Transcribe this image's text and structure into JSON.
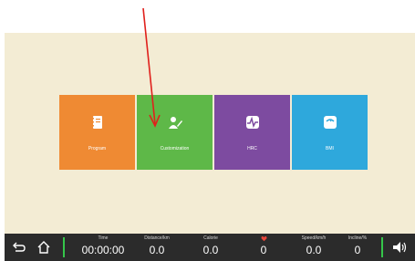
{
  "tiles": [
    {
      "label": "Program",
      "icon": "notebook-icon",
      "color": "#ef8a33"
    },
    {
      "label": "Customization",
      "icon": "user-edit-icon",
      "color": "#5eb848"
    },
    {
      "label": "HRC",
      "icon": "heartbeat-icon",
      "color": "#7d4ba0"
    },
    {
      "label": "BMI",
      "icon": "scale-icon",
      "color": "#2ea8dc"
    }
  ],
  "bottom_bar": {
    "back_icon": "back-arrow-icon",
    "home_icon": "home-icon",
    "volume_icon": "volume-icon",
    "accent_color": "#35c64a",
    "metrics": [
      {
        "label": "Time",
        "value": "00:00:00"
      },
      {
        "label": "Distance/km",
        "value": "0.0"
      },
      {
        "label": "Calorie",
        "value": "0.0"
      },
      {
        "label": "",
        "value": "0",
        "icon": "heart-icon"
      },
      {
        "label": "Speed/km/h",
        "value": "0.0"
      },
      {
        "label": "Incline/%",
        "value": "0"
      }
    ]
  },
  "annotation": {
    "color": "#e0201c",
    "icon": "red-arrow-annotation"
  }
}
